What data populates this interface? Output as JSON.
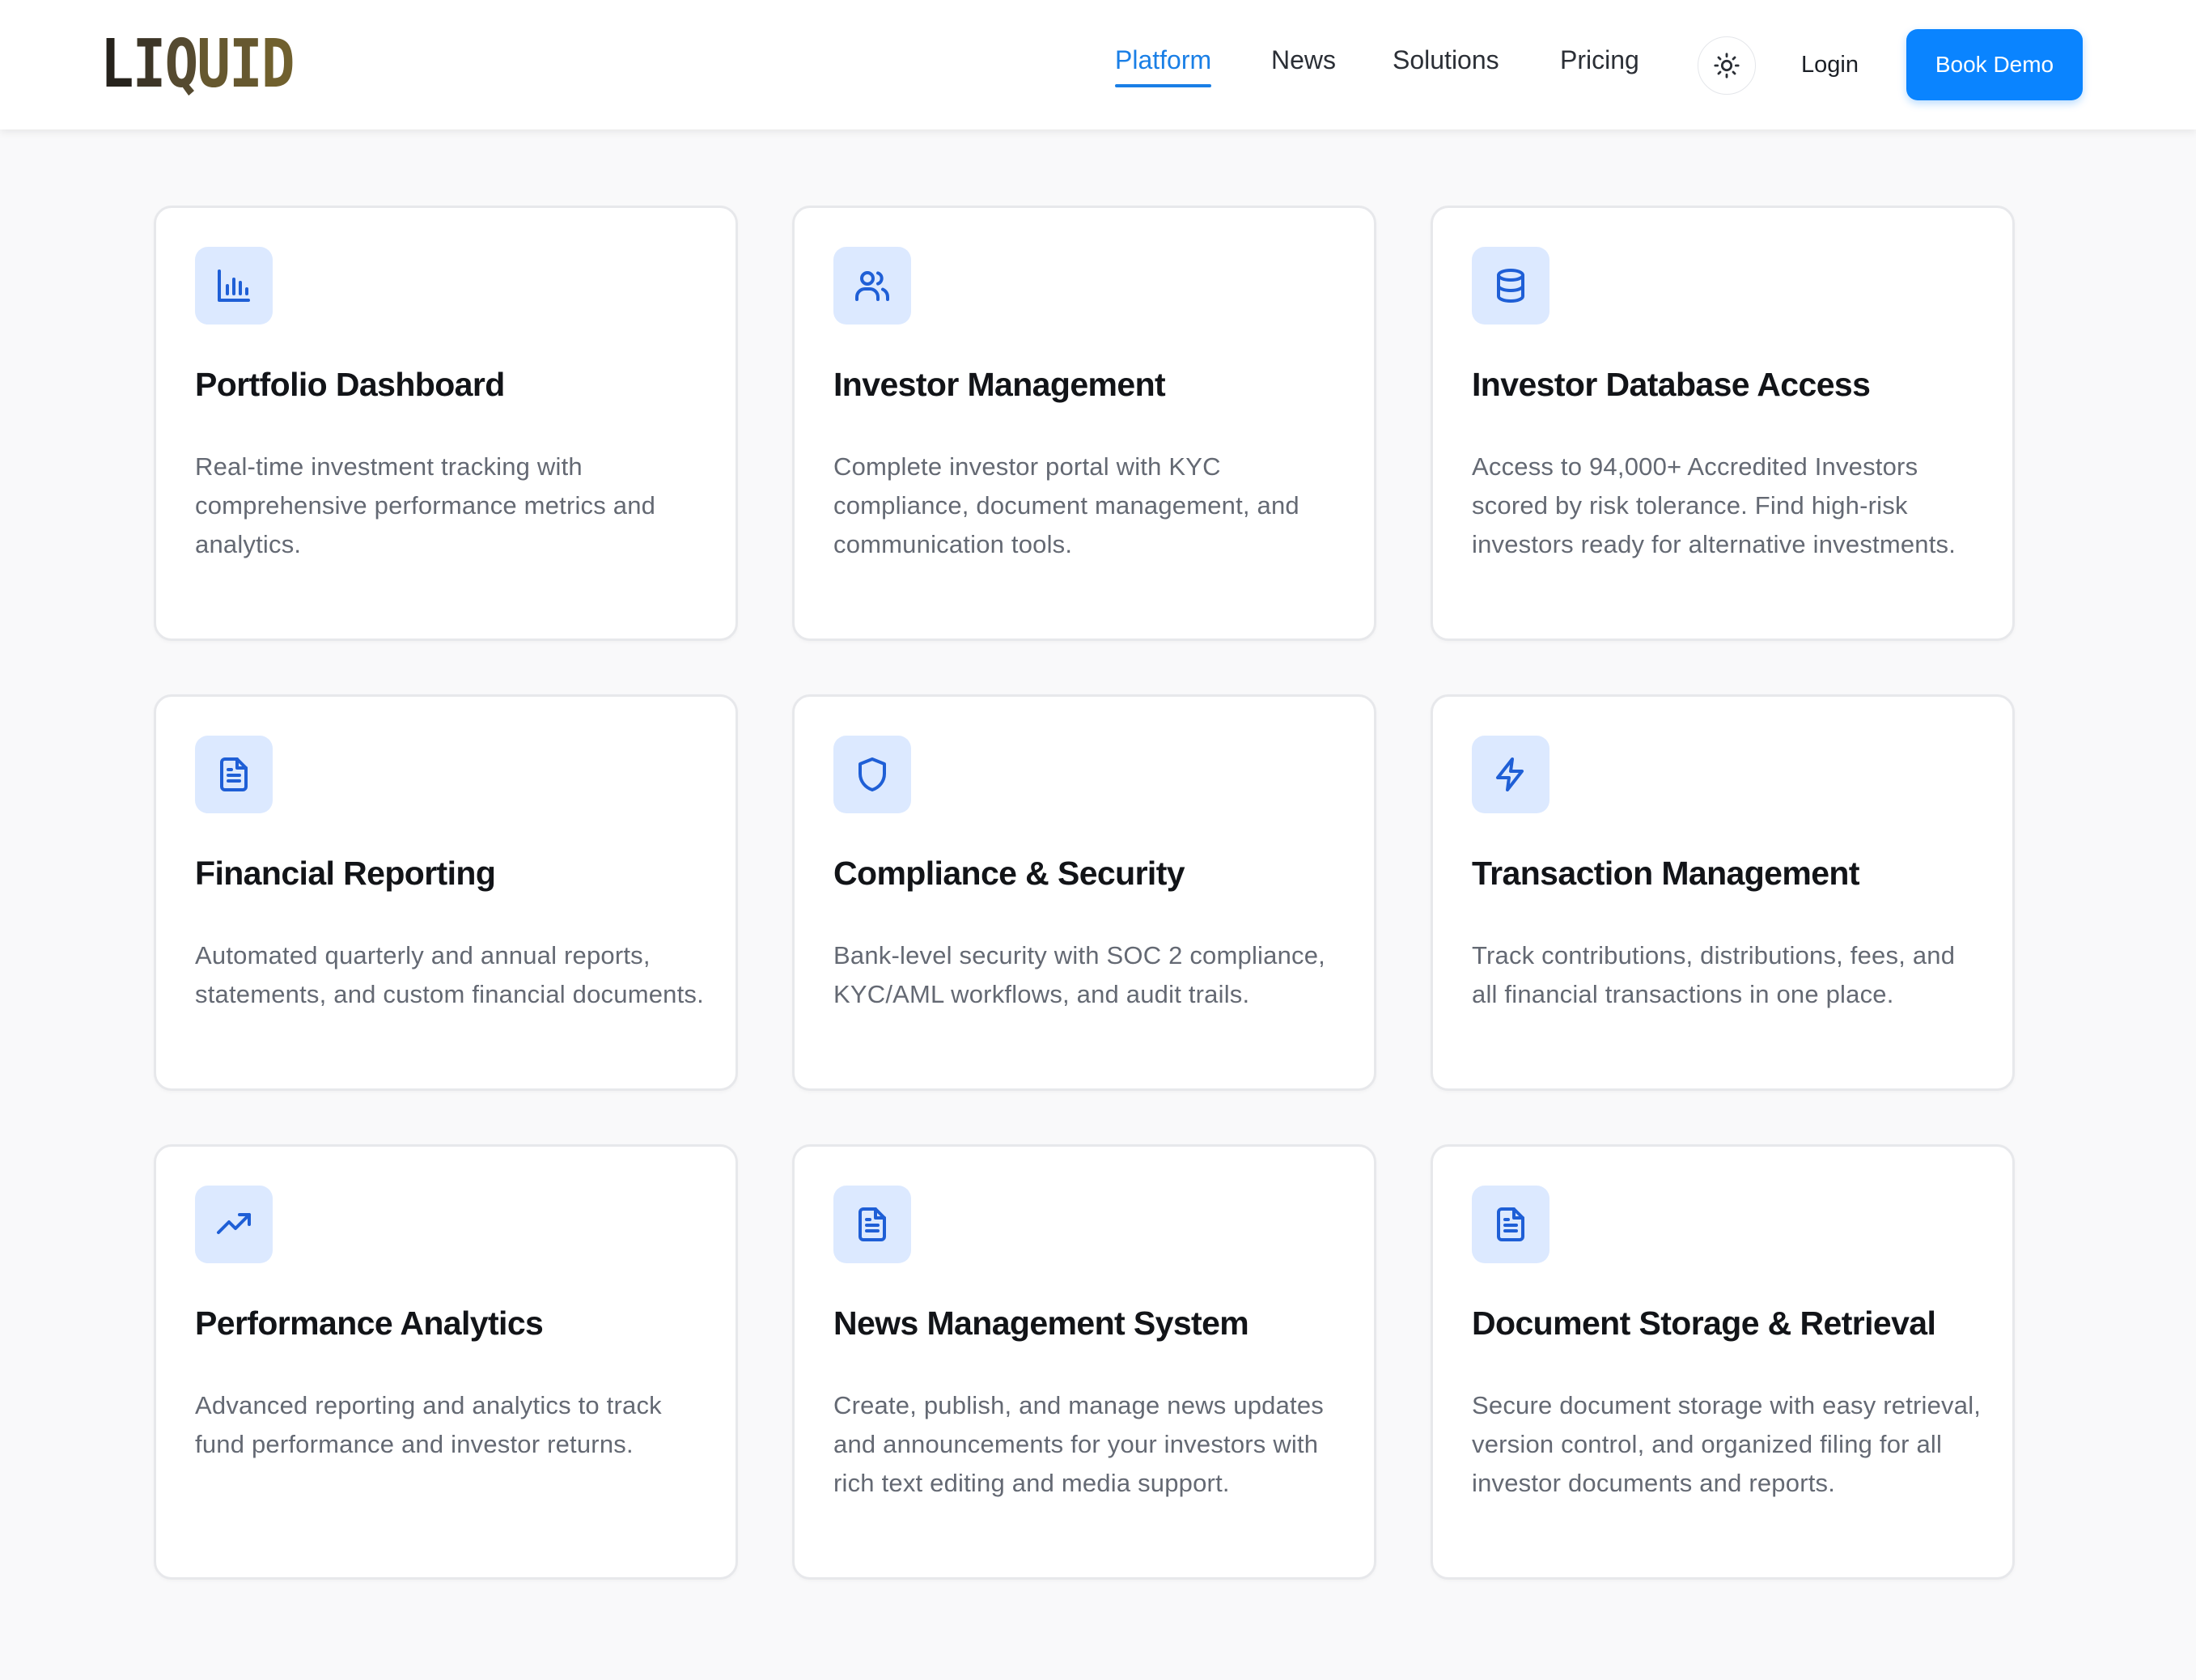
{
  "header": {
    "logo_letters": [
      "L",
      "I",
      "Q",
      "U",
      "I",
      "D"
    ],
    "nav": [
      {
        "label": "Platform",
        "active": true
      },
      {
        "label": "News",
        "active": false
      },
      {
        "label": "Solutions",
        "active": false
      },
      {
        "label": "Pricing",
        "active": false
      }
    ],
    "theme_toggle_icon": "sun-icon",
    "login_label": "Login",
    "book_demo_label": "Book Demo"
  },
  "colors": {
    "accent": "#0a84ff",
    "nav_active": "#1a7fe6",
    "icon_bg": "#dce9ff",
    "icon_stroke": "#1f5fd6"
  },
  "features": [
    {
      "icon": "bar-chart-icon",
      "title": "Portfolio Dashboard",
      "description": "Real-time investment tracking with comprehensive performance metrics and analytics."
    },
    {
      "icon": "users-icon",
      "title": "Investor Management",
      "description": "Complete investor portal with KYC compliance, document management, and communication tools."
    },
    {
      "icon": "database-icon",
      "title": "Investor Database Access",
      "description": "Access to 94,000+ Accredited Investors scored by risk tolerance. Find high-risk investors ready for alternative investments."
    },
    {
      "icon": "file-text-icon",
      "title": "Financial Reporting",
      "description": "Automated quarterly and annual reports, statements, and custom financial documents."
    },
    {
      "icon": "shield-icon",
      "title": "Compliance & Security",
      "description": "Bank-level security with SOC 2 compliance, KYC/AML workflows, and audit trails."
    },
    {
      "icon": "lightning-icon",
      "title": "Transaction Management",
      "description": "Track contributions, distributions, fees, and all financial transactions in one place."
    },
    {
      "icon": "trending-up-icon",
      "title": "Performance Analytics",
      "description": "Advanced reporting and analytics to track fund performance and investor returns."
    },
    {
      "icon": "file-text-icon",
      "title": "News Management System",
      "description": "Create, publish, and manage news updates and announcements for your investors with rich text editing and media support."
    },
    {
      "icon": "file-text-icon",
      "title": "Document Storage & Retrieval",
      "description": "Secure document storage with easy retrieval, version control, and organized filing for all investor documents and reports."
    }
  ]
}
